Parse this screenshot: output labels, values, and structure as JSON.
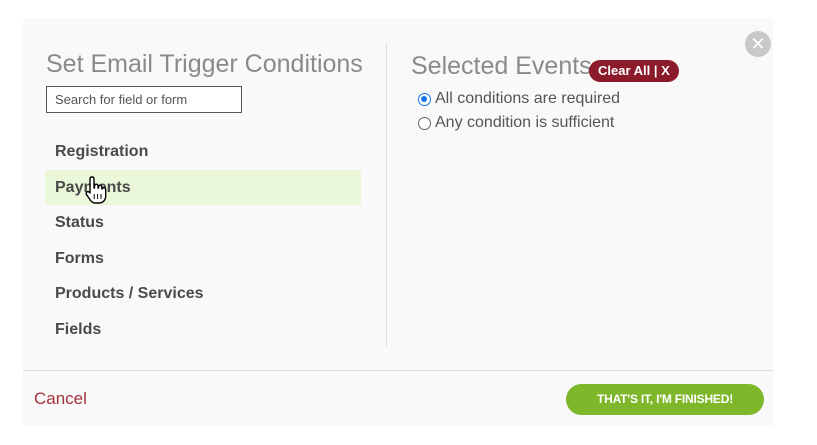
{
  "left_panel": {
    "title": "Set Email Trigger Conditions",
    "search_placeholder": "Search for field or form",
    "items": [
      {
        "label": "Registration"
      },
      {
        "label": "Payments"
      },
      {
        "label": "Status"
      },
      {
        "label": "Forms"
      },
      {
        "label": "Products / Services"
      },
      {
        "label": "Fields"
      }
    ]
  },
  "right_panel": {
    "title": "Selected Events",
    "clear_label": "Clear All | X",
    "options": [
      {
        "label": "All conditions are required",
        "selected": true
      },
      {
        "label": "Any condition is sufficient",
        "selected": false
      }
    ]
  },
  "footer": {
    "cancel_label": "Cancel",
    "finish_label": "THAT'S IT, I'M FINISHED!"
  },
  "icons": {
    "close": "close-icon",
    "cursor": "hand-pointer-icon"
  },
  "colors": {
    "hover_bg": "#eaf7d9",
    "clear_bg": "#8b1a2b",
    "finish_bg": "#7fb72b",
    "cancel_text": "#a0323c",
    "radio_accent": "#1a73e8"
  }
}
